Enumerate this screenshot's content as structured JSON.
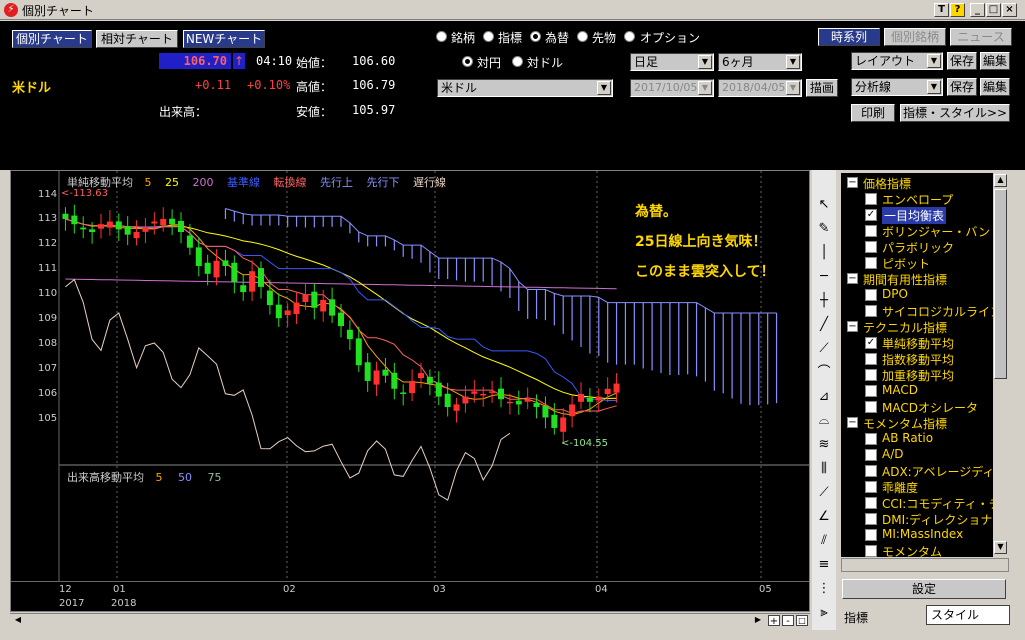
{
  "window": {
    "title": "個別チャート"
  },
  "window_buttons": [
    "T",
    "?",
    "_",
    "□",
    "×"
  ],
  "header": {
    "tabs": [
      "個別チャート",
      "相対チャート",
      "NEWチャート"
    ],
    "symbol_name": "米ドル",
    "price": "106.70",
    "arrow": "↑",
    "time": "04:10",
    "change": "+0.11",
    "change_pct": "+0.10%",
    "open_label": "始値：",
    "open_value": "106.60",
    "high_label": "高値：",
    "high_value": "106.79",
    "low_label": "安値：",
    "low_value": "105.97",
    "volume_label": "出来高："
  },
  "market_radios": [
    {
      "label": "銘柄",
      "selected": false
    },
    {
      "label": "指標",
      "selected": false
    },
    {
      "label": "為替",
      "selected": true
    },
    {
      "label": "先物",
      "selected": false
    },
    {
      "label": "オプション",
      "selected": false
    }
  ],
  "pair_radios": [
    {
      "label": "対円",
      "selected": true
    },
    {
      "label": "対ドル",
      "selected": false
    }
  ],
  "currency_select": "米ドル",
  "period_select": "日足",
  "range_select": "6ヶ月",
  "date_from": "2017/10/05",
  "date_to": "2018/04/05",
  "draw_button": "描画",
  "right_buttons": {
    "timeseries": "時系列",
    "individual": "個別銘柄",
    "news": "ニュース",
    "layout_select": "レイアウト",
    "analysis_select": "分析線",
    "save": "保存",
    "edit": "編集",
    "print": "印刷",
    "indicator_style": "指標・スタイル>>"
  },
  "chart_legend": {
    "title": "単純移動平均",
    "p5": "5",
    "p25": "25",
    "p200": "200",
    "kijun": "基準線",
    "tenkan": "転換線",
    "senkou_up": "先行上",
    "senkou_down": "先行下",
    "chikou": "遅行線",
    "colors": {
      "p5": "#ffa500",
      "p25": "#ffff00",
      "p200": "#d070d0",
      "kijun": "#3a5aff",
      "tenkan": "#ff6060",
      "senkou_up": "#8890ff",
      "senkou_down": "#8890ff",
      "chikou": "#e8d0c0"
    }
  },
  "volume_legend": {
    "title": "出来高移動平均",
    "p5": "5",
    "p50": "50",
    "p75": "75"
  },
  "annotation": [
    "為替。",
    "25日線上向き気味！",
    "このまま雲突入して！"
  ],
  "y_ticks": [
    "114",
    "113",
    "112",
    "111",
    "110",
    "109",
    "108",
    "107",
    "106",
    "105"
  ],
  "high_marker": "<-113.63",
  "low_marker": "<-104.55",
  "x_ticks": [
    "12",
    "01",
    "02",
    "03",
    "04",
    "05"
  ],
  "x_years": [
    "2017",
    "2018"
  ],
  "chart_data": {
    "type": "candlestick",
    "y_range": [
      104.5,
      114.3
    ],
    "closes": [
      113.0,
      112.8,
      112.6,
      112.5,
      112.8,
      112.9,
      112.6,
      112.4,
      112.5,
      112.7,
      112.9,
      113.0,
      112.8,
      112.5,
      111.9,
      111.2,
      110.9,
      111.4,
      111.2,
      110.6,
      110.2,
      111.0,
      110.4,
      109.7,
      109.2,
      109.5,
      109.8,
      110.1,
      109.6,
      109.9,
      109.3,
      108.9,
      108.4,
      107.4,
      106.8,
      107.2,
      107.0,
      106.5,
      106.3,
      106.8,
      107.1,
      106.7,
      106.2,
      105.8,
      105.9,
      106.2,
      106.4,
      106.3,
      106.4,
      106.1,
      106.0,
      105.9,
      106.1,
      105.8,
      105.4,
      105.0,
      105.4,
      105.9,
      106.3,
      106.0,
      106.2,
      106.5,
      106.7
    ],
    "swing_high": 113.63,
    "swing_low": 104.55
  },
  "indicator_tree": {
    "items": [
      {
        "label": "価格指標",
        "cat": true,
        "checked": false
      },
      {
        "label": "エンベロープ",
        "cat": false,
        "checked": false
      },
      {
        "label": "一目均衡表",
        "cat": false,
        "checked": true,
        "highlight": true
      },
      {
        "label": "ボリンジャー・バンド",
        "cat": false,
        "checked": false
      },
      {
        "label": "パラボリック",
        "cat": false,
        "checked": false
      },
      {
        "label": "ピボット",
        "cat": false,
        "checked": false
      },
      {
        "label": "期間有用性指標",
        "cat": true,
        "checked": false
      },
      {
        "label": "DPO",
        "cat": false,
        "checked": false
      },
      {
        "label": "サイコロジカルライン",
        "cat": false,
        "checked": false
      },
      {
        "label": "テクニカル指標",
        "cat": true,
        "checked": false
      },
      {
        "label": "単純移動平均",
        "cat": false,
        "checked": true
      },
      {
        "label": "指数移動平均",
        "cat": false,
        "checked": false
      },
      {
        "label": "加重移動平均",
        "cat": false,
        "checked": false
      },
      {
        "label": "MACD",
        "cat": false,
        "checked": false
      },
      {
        "label": "MACDオシレータ",
        "cat": false,
        "checked": false
      },
      {
        "label": "モメンタム指標",
        "cat": true,
        "checked": false
      },
      {
        "label": "AB Ratio",
        "cat": false,
        "checked": false
      },
      {
        "label": "A/D",
        "cat": false,
        "checked": false
      },
      {
        "label": "ADX:アベレージディレ",
        "cat": false,
        "checked": false
      },
      {
        "label": "乖離度",
        "cat": false,
        "checked": false
      },
      {
        "label": "CCI:コモディティ・チャ",
        "cat": false,
        "checked": false
      },
      {
        "label": "DMI:ディレクショナル",
        "cat": false,
        "checked": false
      },
      {
        "label": "MI:MassIndex",
        "cat": false,
        "checked": false
      },
      {
        "label": "モメンタム",
        "cat": false,
        "checked": false
      }
    ]
  },
  "settings_button": "設定",
  "bottom_tabs": [
    "指標",
    "スタイル"
  ]
}
